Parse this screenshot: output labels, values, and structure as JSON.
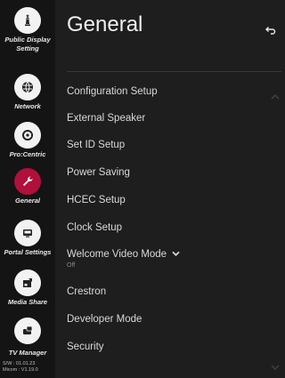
{
  "sidebar": {
    "items": [
      {
        "label": "Public Display Setting",
        "icon": "king-icon"
      },
      {
        "label": "Network",
        "icon": "network-globe-icon"
      },
      {
        "label": "Pro:Centric",
        "icon": "procentric-icon"
      },
      {
        "label": "General",
        "icon": "wrench-icon"
      },
      {
        "label": "Portal Settings",
        "icon": "portal-icon"
      },
      {
        "label": "Media Share",
        "icon": "media-share-icon"
      },
      {
        "label": "TV Manager",
        "icon": "tv-manager-icon"
      }
    ],
    "version_sw": "S/W : 01.01.23",
    "version_micom": "Micom : V1.19.0"
  },
  "header": {
    "title": "General",
    "back_icon": "back-arrow-icon"
  },
  "menu": {
    "items": [
      {
        "label": "Configuration Setup"
      },
      {
        "label": "External Speaker"
      },
      {
        "label": "Set ID Setup"
      },
      {
        "label": "Power Saving"
      },
      {
        "label": "HCEC Setup"
      },
      {
        "label": "Clock Setup"
      },
      {
        "label": "Welcome Video Mode",
        "value": "Off"
      },
      {
        "label": "Crestron"
      },
      {
        "label": "Developer Mode"
      },
      {
        "label": "Security"
      }
    ]
  },
  "colors": {
    "accent": "#b0103a",
    "background": "#1e1e1e",
    "sidebar": "#141414"
  }
}
